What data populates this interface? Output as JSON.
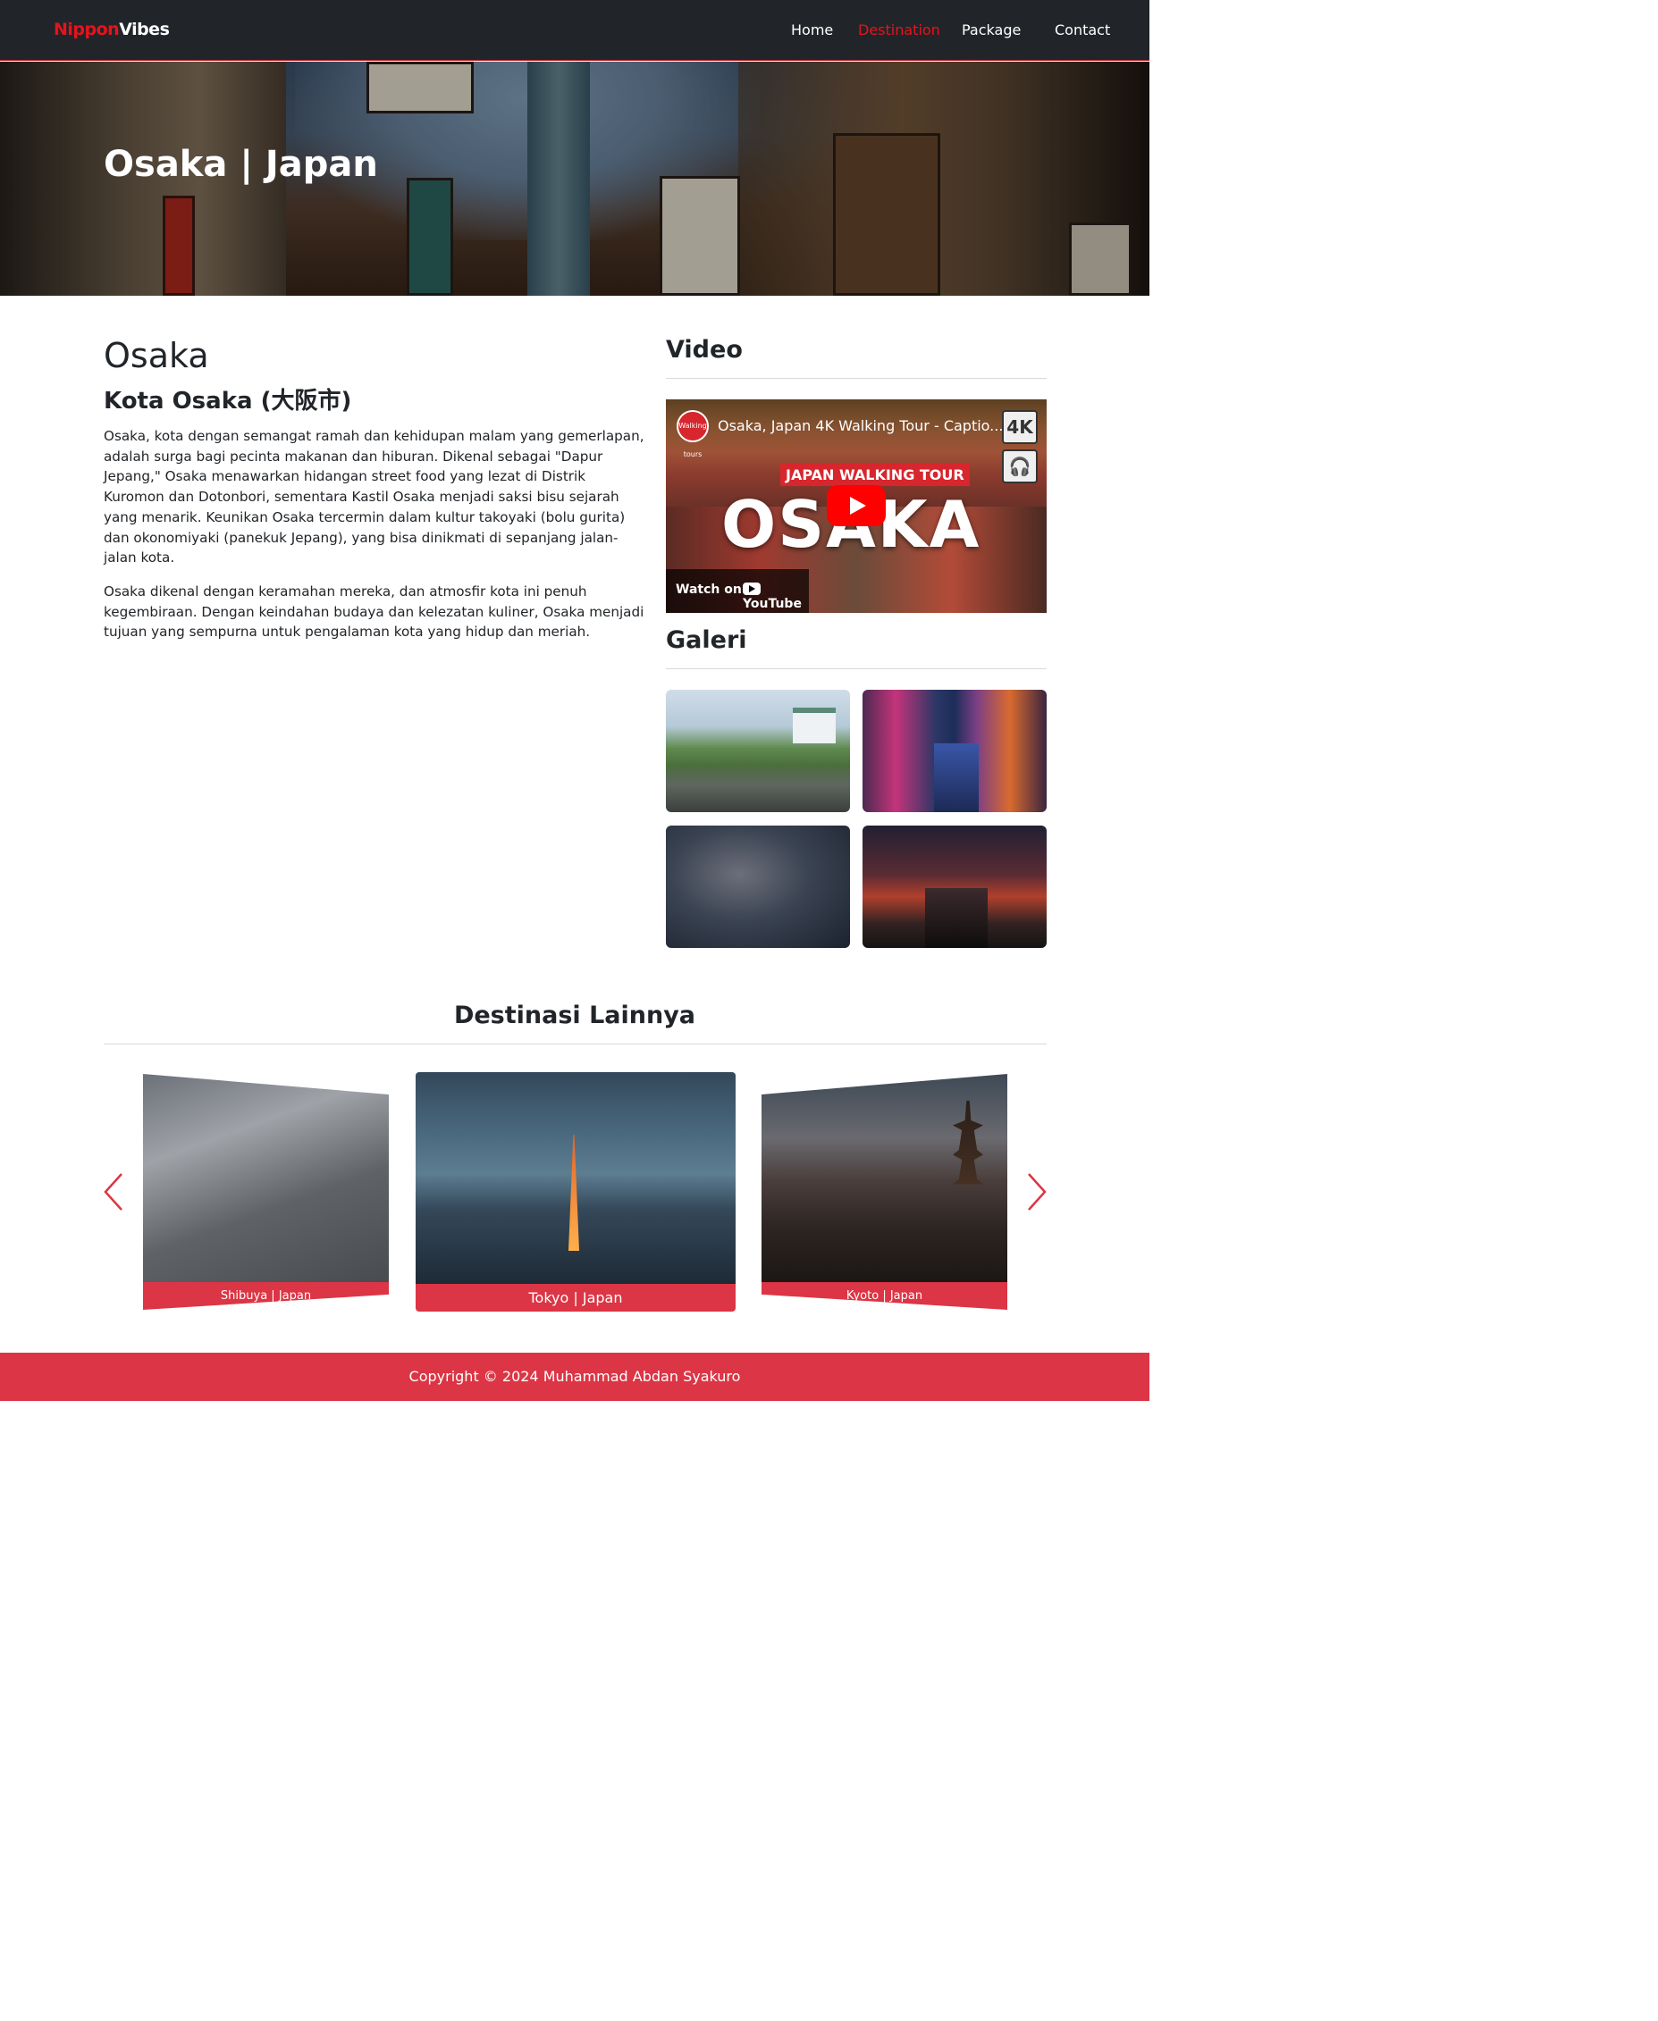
{
  "navbar": {
    "brand_part1": "Nippon",
    "brand_part2": "Vibes",
    "links": [
      {
        "label": "Home"
      },
      {
        "label": "Destination"
      },
      {
        "label": "Package"
      },
      {
        "label": "Contact"
      }
    ],
    "active_link": "Destination",
    "colors": {
      "background": "#212529",
      "accent": "#e8121b"
    }
  },
  "hero": {
    "title": "Osaka | Japan"
  },
  "article": {
    "heading": "Osaka",
    "subheading": "Kota Osaka (大阪市)",
    "paragraphs": [
      "Osaka, kota dengan semangat ramah dan kehidupan malam yang gemerlapan, adalah surga bagi pecinta makanan dan hiburan. Dikenal sebagai \"Dapur Jepang,\" Osaka menawarkan hidangan street food yang lezat di Distrik Kuromon dan Dotonbori, sementara Kastil Osaka menjadi saksi bisu sejarah yang menarik. Keunikan Osaka tercermin dalam kultur takoyaki (bolu gurita) dan okonomiyaki (panekuk Jepang), yang bisa dinikmati di sepanjang jalan-jalan kota.",
      "Osaka dikenal dengan keramahan mereka, dan atmosfir kota ini penuh kegembiraan. Dengan keindahan budaya dan kelezatan kuliner, Osaka menjadi tujuan yang sempurna untuk pengalaman kota yang hidup dan meriah."
    ]
  },
  "sidebar": {
    "video_heading": "Video",
    "video": {
      "title": "Osaka, Japan 4K Walking Tour - Captio...",
      "channel_logo": "Walking tours",
      "banner": "JAPAN WALKING TOUR",
      "big_word": "OSAKA",
      "badge": "4K",
      "headphone_icon": "headphone-icon",
      "watch_on": "Watch on",
      "platform": "YouTube"
    },
    "gallery_heading": "Galeri"
  },
  "destinations": {
    "heading": "Destinasi Lainnya",
    "cards": [
      {
        "caption": "Shibuya | Japan"
      },
      {
        "caption": "Tokyo | Japan"
      },
      {
        "caption": "Kyoto | Japan"
      }
    ],
    "prev_icon": "chevron-left-icon",
    "next_icon": "chevron-right-icon",
    "accent": "#dc3545"
  },
  "footer": {
    "text": "Copyright © 2024 Muhammad Abdan Syakuro",
    "background": "#dc3545"
  }
}
